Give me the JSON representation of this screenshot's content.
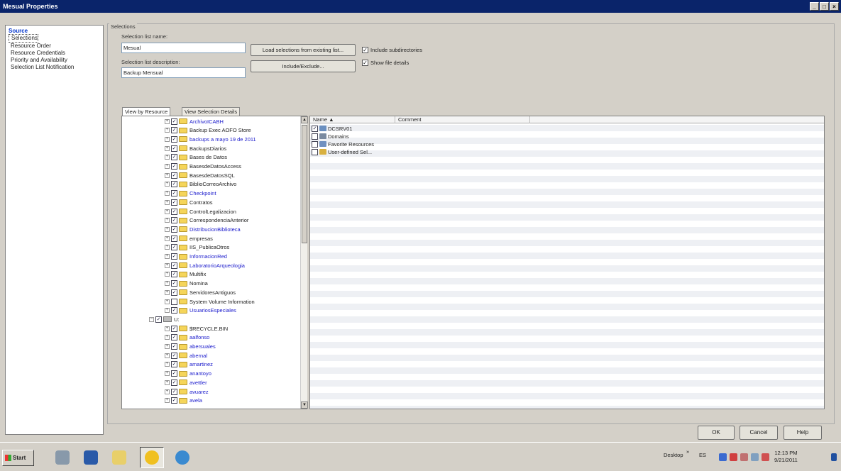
{
  "window": {
    "title": "Mesual Properties",
    "controls": [
      "_",
      "□",
      "×"
    ]
  },
  "nav": {
    "header": "Source",
    "items": [
      "Selections",
      "Resource Order",
      "Resource Credentials",
      "Priority and Availability",
      "Selection List Notification"
    ]
  },
  "selections": {
    "group_label": "Selections",
    "name_label": "Selection list name:",
    "name_value": "Mesual",
    "desc_label": "Selection list description:",
    "desc_value": "Backup Mensual",
    "load_button": "Load selections from existing list...",
    "include_button": "Include/Exclude...",
    "include_subdirs": "Include subdirectories",
    "show_details": "Show file details",
    "tab_resource": "View by Resource",
    "tab_details": "View Selection Details"
  },
  "tree": [
    {
      "label": "ArchivoICABH",
      "blue": true
    },
    {
      "label": "Backup Exec AOFO Store",
      "blue": false
    },
    {
      "label": "backups a mayo 19 de 2011",
      "blue": true
    },
    {
      "label": "BackupsDiarios",
      "blue": false
    },
    {
      "label": "Bases de Datos",
      "blue": false
    },
    {
      "label": "BasesdeDatosAccess",
      "blue": false
    },
    {
      "label": "BasesdeDatosSQL",
      "blue": false
    },
    {
      "label": "BiblioCorreoArchivo",
      "blue": false
    },
    {
      "label": "Checkpoint",
      "blue": true
    },
    {
      "label": "Contratos",
      "blue": false
    },
    {
      "label": "ControlLegalizacion",
      "blue": false
    },
    {
      "label": "CorrespondenciaAnterior",
      "blue": false
    },
    {
      "label": "DistribucionBiblioteca",
      "blue": true
    },
    {
      "label": "empresas",
      "blue": false
    },
    {
      "label": "IIS_PublicaOtros",
      "blue": false
    },
    {
      "label": "InformacionRed",
      "blue": true
    },
    {
      "label": "LaboratorioArqueologia",
      "blue": true
    },
    {
      "label": "Multifix",
      "blue": false
    },
    {
      "label": "Nomina",
      "blue": false
    },
    {
      "label": "ServidoresAntiguos",
      "blue": false
    },
    {
      "label": "System Volume Information",
      "blue": false
    },
    {
      "label": "UsuariosEspeciales",
      "blue": true
    },
    {
      "label": "U:",
      "blue": false
    },
    {
      "label": "$RECYCLE.BIN",
      "blue": false
    },
    {
      "label": "aalfonso",
      "blue": true
    },
    {
      "label": "abersuales",
      "blue": true
    },
    {
      "label": "abernal",
      "blue": true
    },
    {
      "label": "amartinez",
      "blue": true
    },
    {
      "label": "anantoyo",
      "blue": true
    },
    {
      "label": "avettler",
      "blue": true
    },
    {
      "label": "avuarez",
      "blue": true
    },
    {
      "label": "avela",
      "blue": true
    }
  ],
  "list": {
    "col_name": "Name",
    "col_comment": "Comment",
    "rows": [
      "DCSRV01",
      "Domains",
      "Favorite Resources",
      "User-defined Sel..."
    ]
  },
  "buttons": {
    "ok": "OK",
    "cancel": "Cancel",
    "help": "Help"
  },
  "taskbar": {
    "start": "Start",
    "desktop": "Desktop",
    "lang": "ES",
    "time": "12:13 PM",
    "date": "9/21/2011"
  }
}
